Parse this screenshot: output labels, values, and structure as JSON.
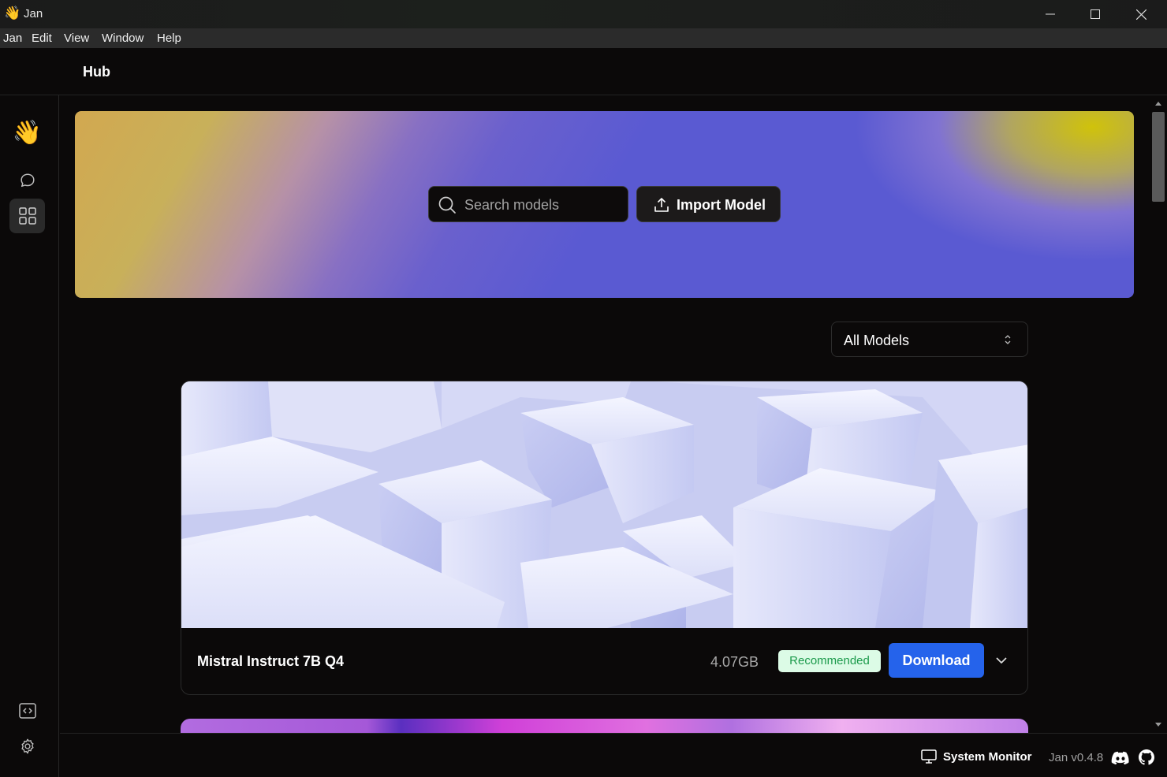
{
  "window": {
    "title": "Jan",
    "app_icon": "waving-hand-emoji",
    "controls": [
      "minimize",
      "maximize",
      "close"
    ]
  },
  "menubar": {
    "items": [
      "Jan",
      "Edit",
      "View",
      "Window",
      "Help"
    ]
  },
  "topbar": {
    "title": "Hub"
  },
  "sidebar": {
    "logo_icon": "waving-hand-emoji",
    "items": [
      {
        "icon": "chat-bubble-icon",
        "active": false
      },
      {
        "icon": "grid-icon",
        "active": true
      }
    ],
    "bottom_items": [
      {
        "icon": "code-icon"
      },
      {
        "icon": "gear-icon"
      }
    ]
  },
  "hero": {
    "search_placeholder": "Search models",
    "import_label": "Import Model"
  },
  "filter": {
    "selected": "All Models"
  },
  "models": [
    {
      "name": "Mistral Instruct 7B Q4",
      "size": "4.07GB",
      "badge": "Recommended",
      "action": "Download"
    }
  ],
  "status": {
    "system_monitor": "System Monitor",
    "version": "Jan v0.4.8"
  },
  "colors": {
    "accent": "#2563eb",
    "badge_bg": "#dcfbe6",
    "badge_text": "#1b9a4b",
    "background": "#0b0909"
  }
}
